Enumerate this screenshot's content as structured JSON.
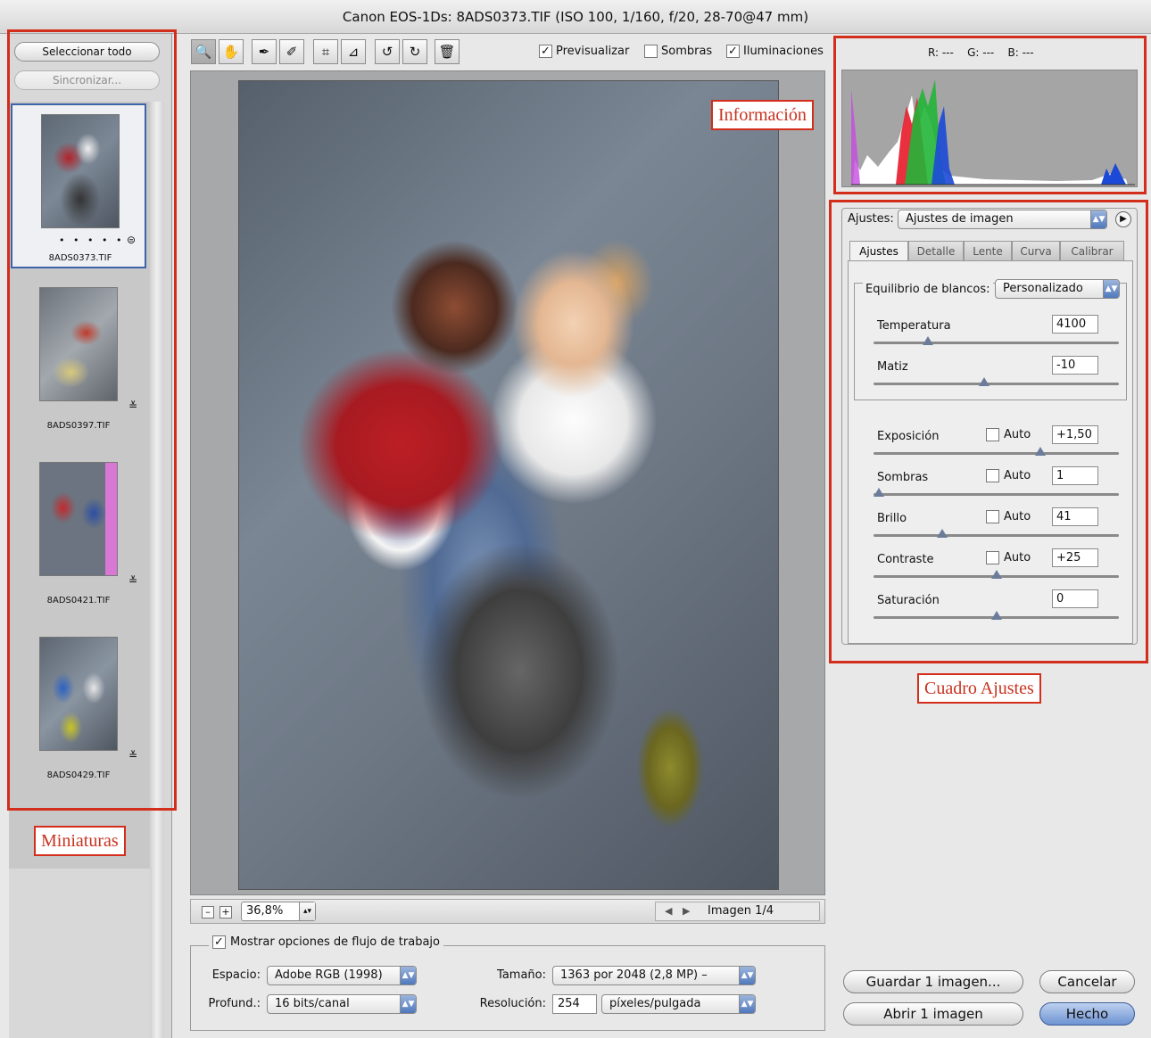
{
  "window": {
    "title": "Canon EOS-1Ds:  8ADS0373.TIF  (ISO 100, 1/160, f/20, 28-70@47 mm)"
  },
  "filmstrip": {
    "select_all": "Seleccionar todo",
    "synchronize": "Sincronizar...",
    "thumbnails": [
      {
        "filename": "8ADS0373.TIF",
        "rating": "• • • • •",
        "selected": true
      },
      {
        "filename": "8ADS0397.TIF",
        "selected": false
      },
      {
        "filename": "8ADS0421.TIF",
        "selected": false
      },
      {
        "filename": "8ADS0429.TIF",
        "selected": false
      }
    ]
  },
  "toolbar": {
    "preview_label": "Previsualizar",
    "preview_checked": true,
    "shadows_label": "Sombras",
    "shadows_checked": false,
    "highlights_label": "Iluminaciones",
    "highlights_checked": true
  },
  "annotations": {
    "info": "Información",
    "settings_box": "Cuadro Ajustes",
    "thumbs": "Miniaturas"
  },
  "histogram": {
    "r": "R: ---",
    "g": "G: ---",
    "b": "B: ---"
  },
  "settings": {
    "label": "Ajustes:",
    "preset": "Ajustes de imagen",
    "tabs": [
      "Ajustes",
      "Detalle",
      "Lente",
      "Curva",
      "Calibrar"
    ],
    "white_balance_label": "Equilibrio de blancos:",
    "white_balance_value": "Personalizado",
    "auto_label": "Auto",
    "sliders": {
      "temperature": {
        "label": "Temperatura",
        "value": "4100",
        "level": 0.22
      },
      "tint": {
        "label": "Matiz",
        "value": "-10",
        "level": 0.45
      },
      "exposure": {
        "label": "Exposición",
        "value": "+1,50",
        "level": 0.68
      },
      "shadows": {
        "label": "Sombras",
        "value": "1",
        "level": 0.02
      },
      "brightness": {
        "label": "Brillo",
        "value": "41",
        "level": 0.28
      },
      "contrast": {
        "label": "Contraste",
        "value": "+25",
        "level": 0.5
      },
      "saturation": {
        "label": "Saturación",
        "value": "0",
        "level": 0.5
      }
    }
  },
  "zoom": {
    "value": "36,8%",
    "minus": "–",
    "plus": "+"
  },
  "image_nav": {
    "label": "Imagen 1/4"
  },
  "workflow": {
    "toggle_label": "Mostrar opciones de flujo de trabajo",
    "toggle_checked": true,
    "space_label": "Espacio:",
    "space_value": "Adobe RGB (1998)",
    "depth_label": "Profund.:",
    "depth_value": "16 bits/canal",
    "size_label": "Tamaño:",
    "size_value": "1363 por 2048  (2,8 MP)  –",
    "resolution_label": "Resolución:",
    "resolution_value": "254",
    "resolution_unit": "píxeles/pulgada"
  },
  "buttons": {
    "save": "Guardar 1 imagen...",
    "cancel": "Cancelar",
    "open": "Abrir 1 imagen",
    "done": "Hecho"
  },
  "colors": {
    "annotation": "#d32d1c",
    "accent": "#4f78bd"
  }
}
